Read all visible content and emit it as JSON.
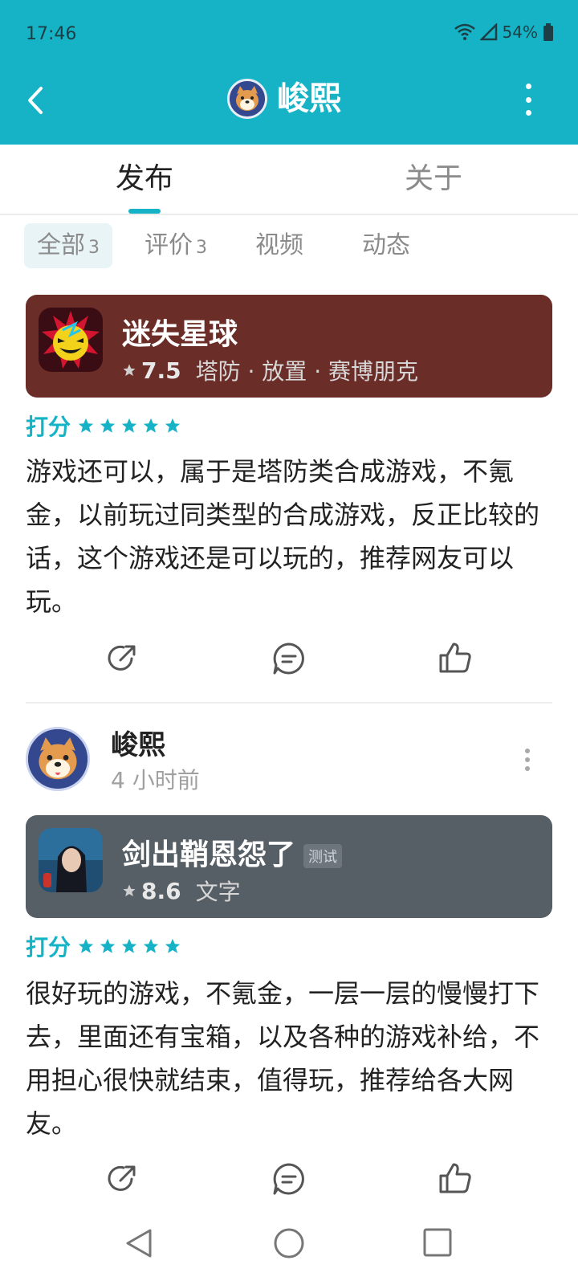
{
  "status_bar": {
    "time": "17:46",
    "battery": "54%"
  },
  "header": {
    "title": "峻熙"
  },
  "main_tabs": [
    {
      "label": "发布"
    },
    {
      "label": "关于"
    }
  ],
  "sub_tabs": [
    {
      "label": "全部",
      "count": "3"
    },
    {
      "label": "评价",
      "count": "3"
    },
    {
      "label": "视频",
      "count": ""
    },
    {
      "label": "动态",
      "count": ""
    }
  ],
  "posts": [
    {
      "game": {
        "name": "迷失星球",
        "rating": "7.5",
        "tags": "塔防 · 放置 · 赛博朋克",
        "badge": ""
      },
      "score_label": "打分",
      "stars": 5,
      "text": "游戏还可以，属于是塔防类合成游戏，不氪金，以前玩过同类型的合成游戏，反正比较的话，这个游戏还是可以玩的，推荐网友可以玩。"
    },
    {
      "author": {
        "name": "峻熙",
        "time": "4 小时前"
      },
      "game": {
        "name": "剑出鞘恩怨了",
        "rating": "8.6",
        "tags": "文字",
        "badge": "测试"
      },
      "score_label": "打分",
      "stars": 5,
      "text": "很好玩的游戏，不氪金，一层一层的慢慢打下去，里面还有宝箱，以及各种的游戏补给，不用担心很快就结束，值得玩，推荐给各大网友。"
    }
  ],
  "colors": {
    "accent": "#16b3c6",
    "card1": "#6b2d28",
    "card2": "#565e66"
  }
}
